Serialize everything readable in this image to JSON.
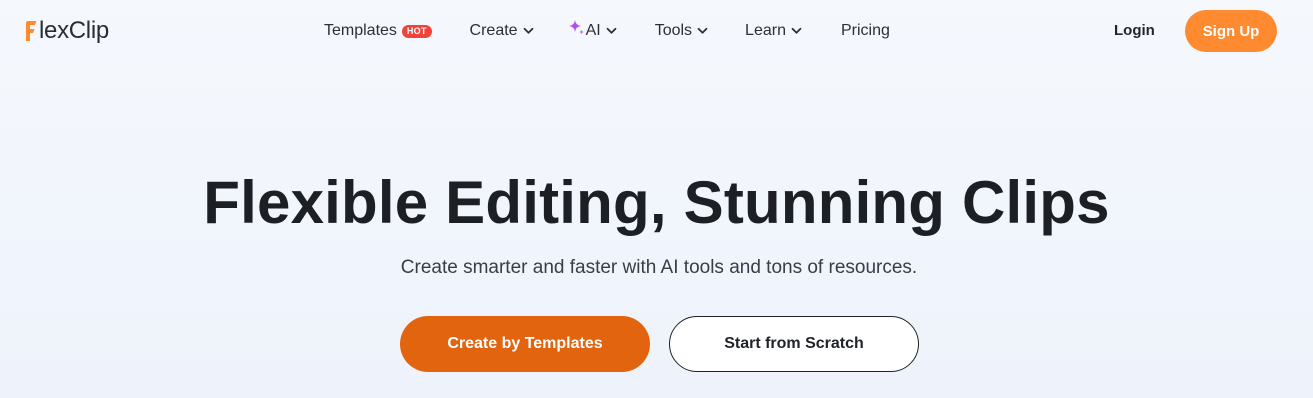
{
  "header": {
    "logo": {
      "text": "lexClip",
      "mark": "F",
      "brand_color": "#ff8a2f"
    },
    "nav": {
      "templates": {
        "label": "Templates",
        "badge": "HOT",
        "badge_color": "#f0433a"
      },
      "create": {
        "label": "Create",
        "icon": "chevron-down-icon"
      },
      "ai": {
        "label": "AI",
        "icon": "sparkle-icon",
        "icon_color": "#b04ff0"
      },
      "tools": {
        "label": "Tools",
        "icon": "chevron-down-icon"
      },
      "learn": {
        "label": "Learn",
        "icon": "chevron-down-icon"
      },
      "pricing": {
        "label": "Pricing"
      }
    },
    "login_label": "Login",
    "signup_label": "Sign Up",
    "signup_color": "#ff8a2f"
  },
  "hero": {
    "title": "Flexible Editing, Stunning Clips",
    "subtitle": "Create smarter and faster with AI tools and tons of resources.",
    "primary_cta": "Create by Templates",
    "primary_cta_color": "#e2640f",
    "secondary_cta": "Start from Scratch"
  }
}
